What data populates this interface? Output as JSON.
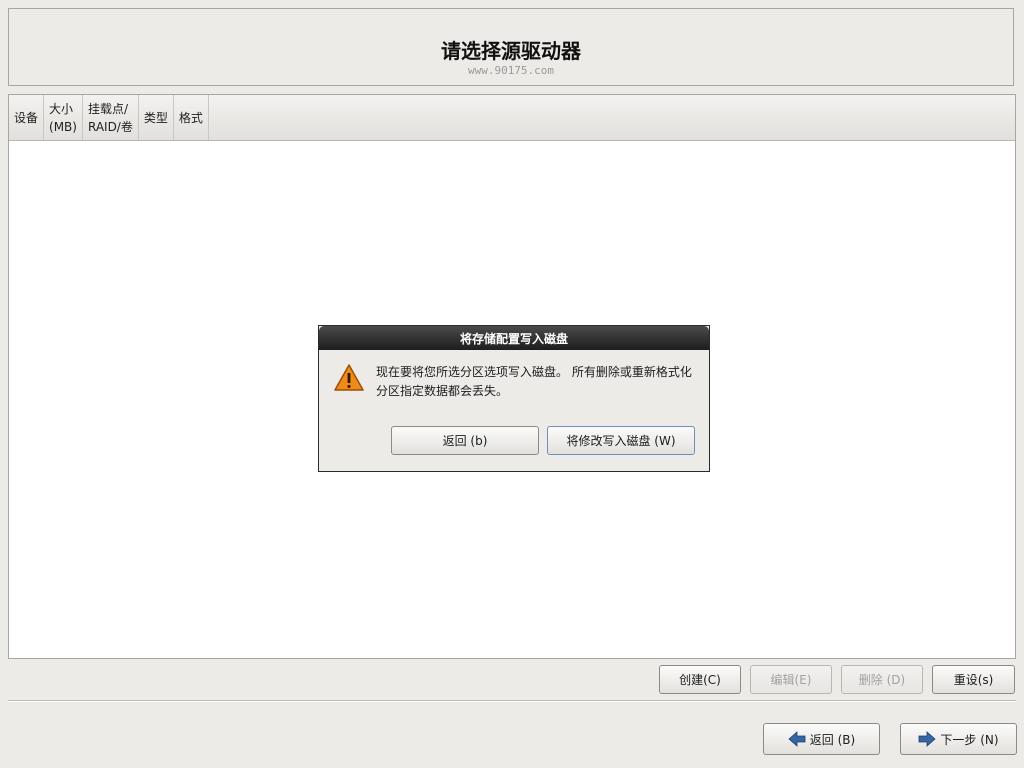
{
  "header": {
    "title": "请选择源驱动器",
    "watermark": "www.90175.com"
  },
  "table": {
    "columns": [
      "设备",
      "大小\n(MB)",
      "挂载点/\nRAID/卷",
      "类型",
      "格式"
    ]
  },
  "actions": {
    "create": "创建(C)",
    "edit": "编辑(E)",
    "delete": "删除 (D)",
    "reset": "重设(s)"
  },
  "nav": {
    "back": "返回 (B)",
    "next": "下一步 (N)"
  },
  "dialog": {
    "title": "将存储配置写入磁盘",
    "message": "现在要将您所选分区选项写入磁盘。 所有删除或重新格式化分区指定数据都会丢失。",
    "back_button": "返回 (b)",
    "write_button": "将修改写入磁盘 (W)"
  },
  "colors": {
    "background": "#edebe8",
    "warning_icon": "#f08a1c",
    "arrow_icon": "#3465a4"
  },
  "icons": {
    "warning": "warning-icon",
    "back": "back-arrow-icon",
    "next": "next-arrow-icon"
  }
}
